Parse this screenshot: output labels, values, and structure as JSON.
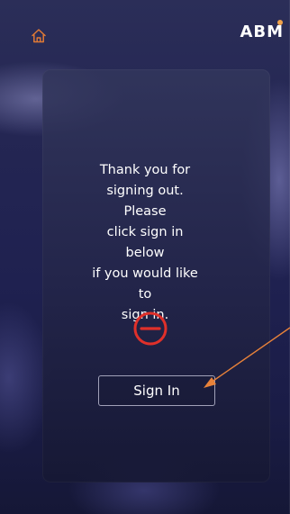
{
  "header": {
    "home_icon": "home-icon",
    "logo_text": "ABM",
    "accent_color": "#f0a14a"
  },
  "signout_panel": {
    "message": "Thank you for\nsigning out. Please\nclick sign in below\nif you would like to\nsign in.",
    "status_icon": "minus-circle-icon",
    "status_color": "#e0302a",
    "sign_in_label": "Sign In"
  },
  "annotation": {
    "arrow_color": "#e8823a"
  }
}
